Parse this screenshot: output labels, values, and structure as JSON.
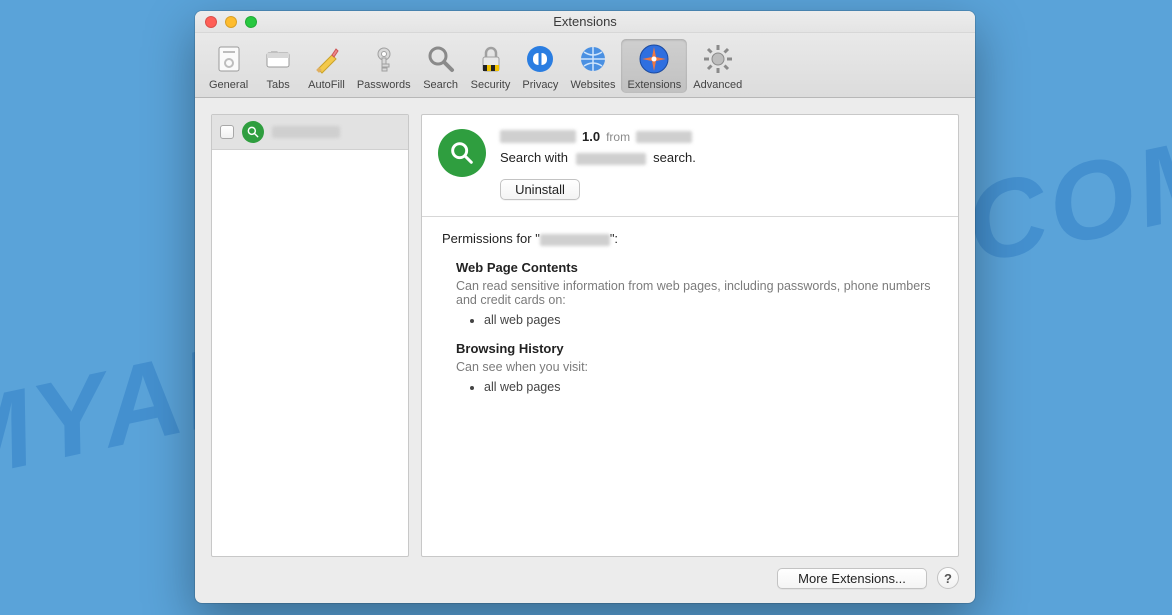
{
  "watermark": "MYANTISPYWARE.COM",
  "window": {
    "title": "Extensions"
  },
  "toolbar": {
    "items": [
      {
        "id": "general",
        "label": "General"
      },
      {
        "id": "tabs",
        "label": "Tabs"
      },
      {
        "id": "autofill",
        "label": "AutoFill"
      },
      {
        "id": "passwords",
        "label": "Passwords"
      },
      {
        "id": "search",
        "label": "Search"
      },
      {
        "id": "security",
        "label": "Security"
      },
      {
        "id": "privacy",
        "label": "Privacy"
      },
      {
        "id": "websites",
        "label": "Websites"
      },
      {
        "id": "extensions",
        "label": "Extensions"
      },
      {
        "id": "advanced",
        "label": "Advanced"
      }
    ],
    "active": "extensions"
  },
  "sidebar": {
    "ext_name_blur_width": 68
  },
  "ext": {
    "version": "1.0",
    "from_label": "from",
    "desc_prefix": "Search with",
    "desc_suffix": "search.",
    "uninstall_label": "Uninstall"
  },
  "permissions": {
    "title_prefix": "Permissions for \"",
    "title_suffix": "\":",
    "sections": [
      {
        "heading": "Web Page Contents",
        "desc": "Can read sensitive information from web pages, including passwords, phone numbers and credit cards on:",
        "items": [
          "all web pages"
        ]
      },
      {
        "heading": "Browsing History",
        "desc": "Can see when you visit:",
        "items": [
          "all web pages"
        ]
      }
    ]
  },
  "footer": {
    "more_label": "More Extensions...",
    "help": "?"
  }
}
